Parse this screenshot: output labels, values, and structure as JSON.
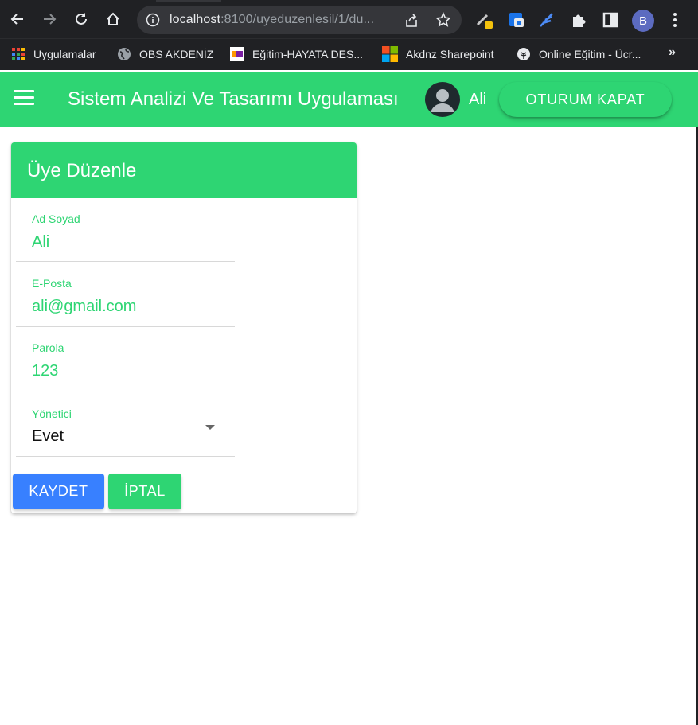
{
  "browser": {
    "url_host": "localhost",
    "url_rest": ":8100/uyeduzenlesil/1/du...",
    "profile_initial": "B",
    "bookmarks": [
      {
        "label": "Uygulamalar",
        "icon": "apps-grid-icon"
      },
      {
        "label": "OBS AKDENİZ",
        "icon": "globe-icon"
      },
      {
        "label": "Eğitim-HAYATA DES...",
        "icon": "site-logo-icon"
      },
      {
        "label": "Akdnz Sharepoint",
        "icon": "microsoft-logo-icon"
      },
      {
        "label": "Online Eğitim - Ücr...",
        "icon": "tree-icon"
      }
    ],
    "bookmarks_more": "»"
  },
  "toolbar": {
    "title": "Sistem Analizi Ve Tasarımı Uygulaması",
    "user_name": "Ali",
    "logout_label": "OTURUM KAPAT"
  },
  "card": {
    "title": "Üye Düzenle",
    "fields": [
      {
        "label": "Ad Soyad",
        "value": "Ali"
      },
      {
        "label": "E-Posta",
        "value": "ali@gmail.com"
      },
      {
        "label": "Parola",
        "value": "123"
      },
      {
        "label": "Yönetici",
        "value": "Evet"
      }
    ],
    "save_label": "KAYDET",
    "cancel_label": "İPTAL"
  },
  "colors": {
    "primary": "#2ed573",
    "save": "#3880ff",
    "chrome": "#202124"
  }
}
